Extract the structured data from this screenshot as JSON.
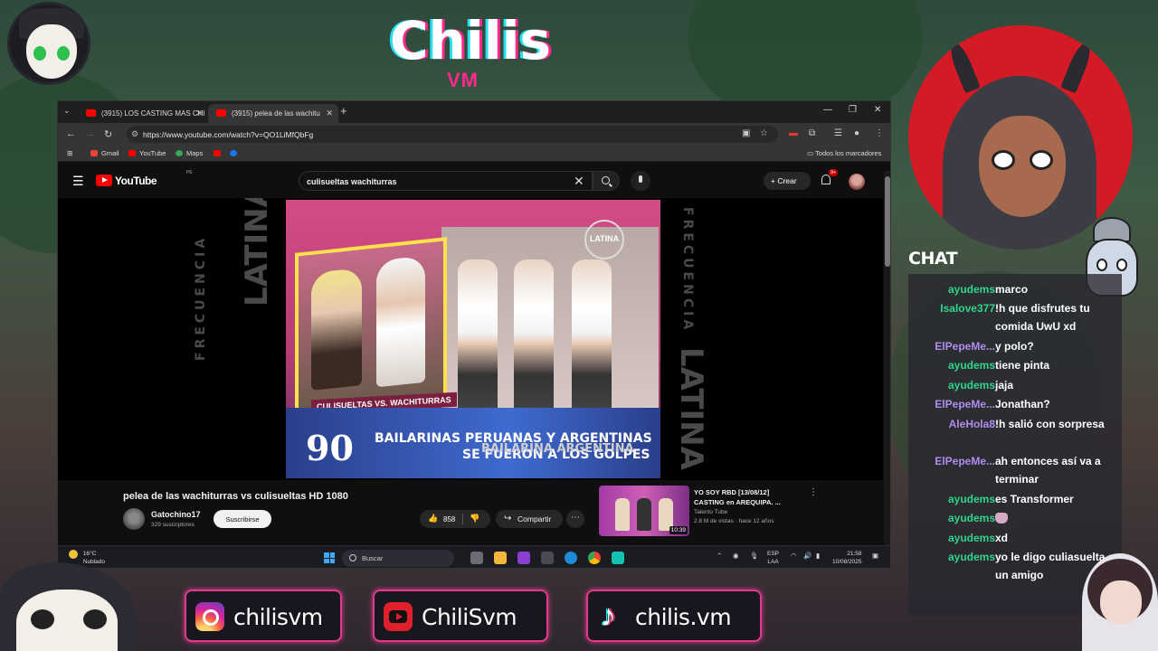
{
  "overlay": {
    "logo_main": "Chilis",
    "logo_sub": "VM",
    "chat_title": "CHAT",
    "socials": [
      {
        "icon": "instagram-icon",
        "label": "chilisvm"
      },
      {
        "icon": "youtube-icon",
        "label": "ChiliSvm"
      },
      {
        "icon": "tiktok-icon",
        "label": "chilis.vm"
      }
    ],
    "accent_color": "#e13a8c"
  },
  "chat": [
    {
      "user": "ayudems",
      "msg": "marco",
      "color": "green"
    },
    {
      "user": "Isalove377",
      "msg": "!h que disfrutes tu comida UwU xd",
      "color": "green"
    },
    {
      "user": "ElPepeMe...",
      "msg": "y polo?",
      "color": "purple"
    },
    {
      "user": "ayudems",
      "msg": "tiene pinta",
      "color": "green"
    },
    {
      "user": "ayudems",
      "msg": "jaja",
      "color": "green"
    },
    {
      "user": "ElPepeMe...",
      "msg": "Jonathan?",
      "color": "purple"
    },
    {
      "user": "AleHola8",
      "msg": "!h salió con sorpresa",
      "color": "purple"
    },
    {
      "user": "ElPepeMe...",
      "msg": "ah entonces así va a terminar",
      "color": "purple"
    },
    {
      "user": "ayudems",
      "msg": "es Transformer",
      "color": "green"
    },
    {
      "user": "ayudems",
      "msg": "",
      "emote": "emote-icon",
      "color": "green"
    },
    {
      "user": "ayudems",
      "msg": "xd",
      "color": "green"
    },
    {
      "user": "ayudems",
      "msg": "yo le digo culiasuelta a un amigo",
      "color": "green"
    }
  ],
  "browser": {
    "tabs": [
      {
        "label": "(3915) LOS CASTING MAS CHI",
        "active": false
      },
      {
        "label": "(3915) pelea de las wachitu",
        "active": true
      }
    ],
    "url": "https://www.youtube.com/watch?v=QO1LiMfQbFg",
    "bookmarks": [
      "Gmail",
      "YouTube",
      "Maps"
    ],
    "all_bookmarks": "Todos los marcadores"
  },
  "youtube": {
    "logo": "YouTube",
    "region": "PE",
    "search_value": "culisueltas wachiturras",
    "create_label": "Crear",
    "notif_badge": "9+",
    "video": {
      "title": "pelea de las wachiturras vs culisueltas HD 1080",
      "channel": "Gatochino17",
      "subscribers": "329 suscriptores",
      "subscribe_label": "Suscribirse",
      "likes": "858",
      "share_label": "Compartir",
      "frame": {
        "side_text_small": "FRECUENCIA",
        "side_text_big": "LATINA",
        "channel_bug": "LATINA",
        "inset_label": "CULISUELTAS VS. WACHITURRAS",
        "number": "90",
        "line1": "BAILARINAS PERUANAS Y ARGENTINAS",
        "line2": "SE FUERON A LOS GOLPES",
        "line3": "BAILARINA ARGENTINA"
      }
    },
    "recommended": {
      "title": "YO SOY RBD [13/08/12] CASTING en AREQUIPA. ...",
      "channel": "Talento Tube",
      "meta": "2.8 M de vistas · hace 12 años",
      "duration": "10:39"
    }
  },
  "taskbar": {
    "temp": "16°C",
    "weather": "Nublado",
    "search_placeholder": "Buscar",
    "lang1": "ESP",
    "lang2": "LAA",
    "time": "21:58",
    "date": "10/08/2025"
  }
}
